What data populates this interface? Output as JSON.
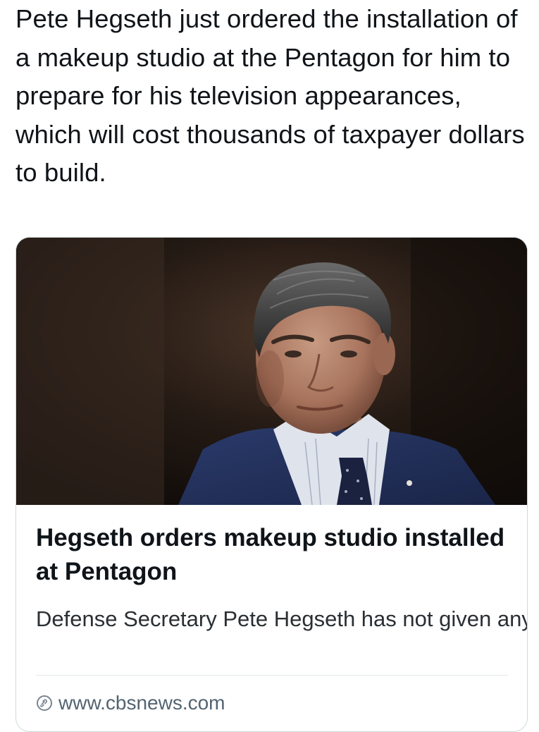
{
  "post": {
    "text": "Pete Hegseth just ordered the installation of a makeup studio at the Pentagon for him to prepare for his television appearances, which will cost thousands of taxpayer dollars to build."
  },
  "link_card": {
    "image_icon": "news-photo",
    "title": "Hegseth orders makeup studio installed at Pentagon",
    "description": "Defense Secretary Pete Hegseth has not given any press briefings in the briefin...",
    "source": "www.cbsnews.com",
    "source_icon": "link-icon"
  },
  "colors": {
    "text": "#0f1419",
    "secondary": "#536471",
    "border": "#cfd9de"
  }
}
